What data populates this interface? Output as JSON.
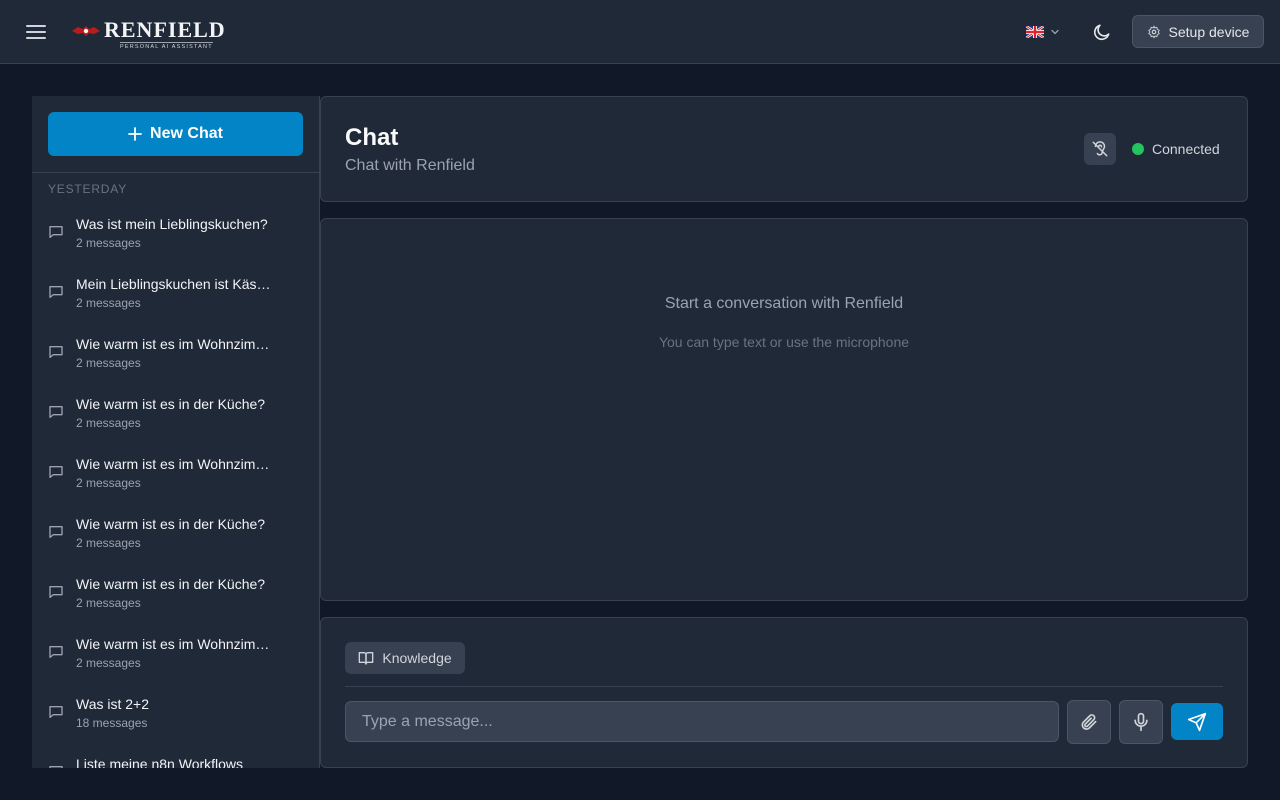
{
  "app": {
    "logo_text": "RENFIELD",
    "logo_subtitle": "PERSONAL AI ASSISTANT",
    "language": "English",
    "setup_device_label": "Setup device"
  },
  "icons": {
    "menu": "hamburger-icon",
    "flag": "uk-flag-icon",
    "theme": "moon-icon",
    "settings": "gear-icon",
    "plus": "plus-icon",
    "chat": "message-square-icon",
    "ear": "ear-off-icon",
    "book": "book-open-icon",
    "attach": "paperclip-icon",
    "mic": "microphone-icon",
    "send": "send-icon"
  },
  "colors": {
    "accent": "#0284c7",
    "connected": "#22c55e",
    "background": "#111827",
    "surface": "#1f2937"
  },
  "sidebar": {
    "new_chat_label": "New Chat",
    "group_label": "YESTERDAY",
    "conversations": [
      {
        "title": "Was ist mein Lieblingskuchen?",
        "count": "2 messages"
      },
      {
        "title": "Mein Lieblingskuchen ist Käs…",
        "count": "2 messages"
      },
      {
        "title": "Wie warm ist es im Wohnzim…",
        "count": "2 messages"
      },
      {
        "title": "Wie warm ist es in der Küche?",
        "count": "2 messages"
      },
      {
        "title": "Wie warm ist es im Wohnzim…",
        "count": "2 messages"
      },
      {
        "title": "Wie warm ist es in der Küche?",
        "count": "2 messages"
      },
      {
        "title": "Wie warm ist es in der Küche?",
        "count": "2 messages"
      },
      {
        "title": "Wie warm ist es im Wohnzim…",
        "count": "2 messages"
      },
      {
        "title": "Was ist 2+2",
        "count": "18 messages"
      },
      {
        "title": "Liste meine n8n Workflows",
        "count": ""
      }
    ]
  },
  "chat": {
    "title": "Chat",
    "subtitle": "Chat with Renfield",
    "status": "Connected",
    "empty_title": "Start a conversation with Renfield",
    "empty_subtitle": "You can type text or use the microphone"
  },
  "composer": {
    "knowledge_label": "Knowledge",
    "placeholder": "Type a message...",
    "value": ""
  }
}
